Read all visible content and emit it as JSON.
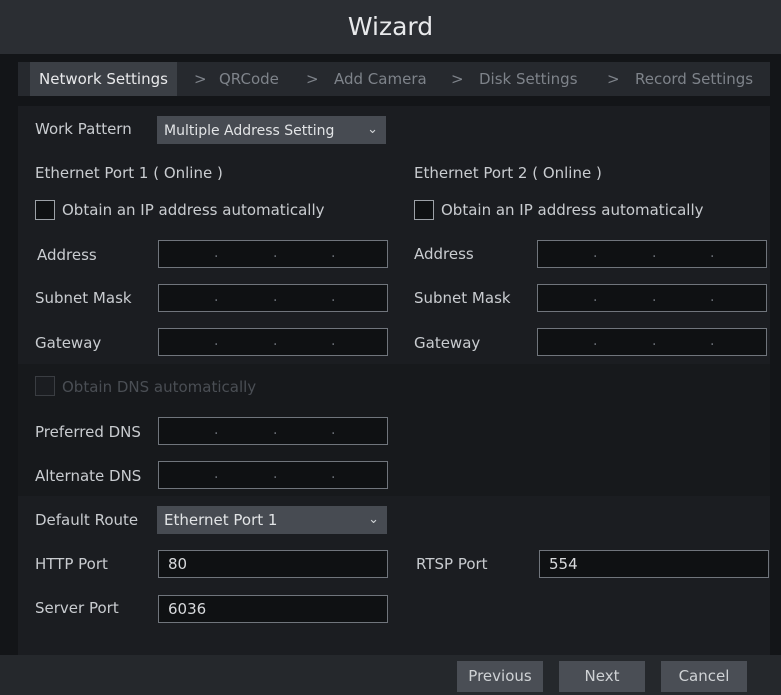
{
  "window": {
    "title": "Wizard"
  },
  "steps": [
    {
      "label": "Network Settings",
      "active": true
    },
    {
      "label": "QRCode",
      "active": false
    },
    {
      "label": "Add Camera",
      "active": false
    },
    {
      "label": "Disk Settings",
      "active": false
    },
    {
      "label": "Record Settings",
      "active": false
    }
  ],
  "step_separator": ">",
  "work_pattern": {
    "label": "Work Pattern",
    "value": "Multiple Address Setting"
  },
  "port1": {
    "title": "Ethernet Port 1 ( Online )",
    "obtain_label": "Obtain an IP address automatically",
    "obtain_checked": false,
    "address_label": "Address",
    "subnet_label": "Subnet Mask",
    "gateway_label": "Gateway"
  },
  "port2": {
    "title": "Ethernet Port 2 ( Online )",
    "obtain_label": "Obtain an IP address automatically",
    "obtain_checked": false,
    "address_label": "Address",
    "subnet_label": "Subnet Mask",
    "gateway_label": "Gateway"
  },
  "ip_separator": ".",
  "dns": {
    "obtain_label": "Obtain DNS automatically",
    "obtain_checked": false,
    "obtain_disabled": true,
    "preferred_label": "Preferred DNS",
    "alternate_label": "Alternate DNS"
  },
  "default_route": {
    "label": "Default Route",
    "value": "Ethernet Port 1"
  },
  "http_port": {
    "label": "HTTP Port",
    "value": "80"
  },
  "rtsp_port": {
    "label": "RTSP Port",
    "value": "554"
  },
  "server_port": {
    "label": "Server Port",
    "value": "6036"
  },
  "buttons": {
    "previous": "Previous",
    "next": "Next",
    "cancel": "Cancel"
  },
  "icons": {
    "dropdown": "chevron-down-icon",
    "step_separator": "chevron-right-icon"
  }
}
